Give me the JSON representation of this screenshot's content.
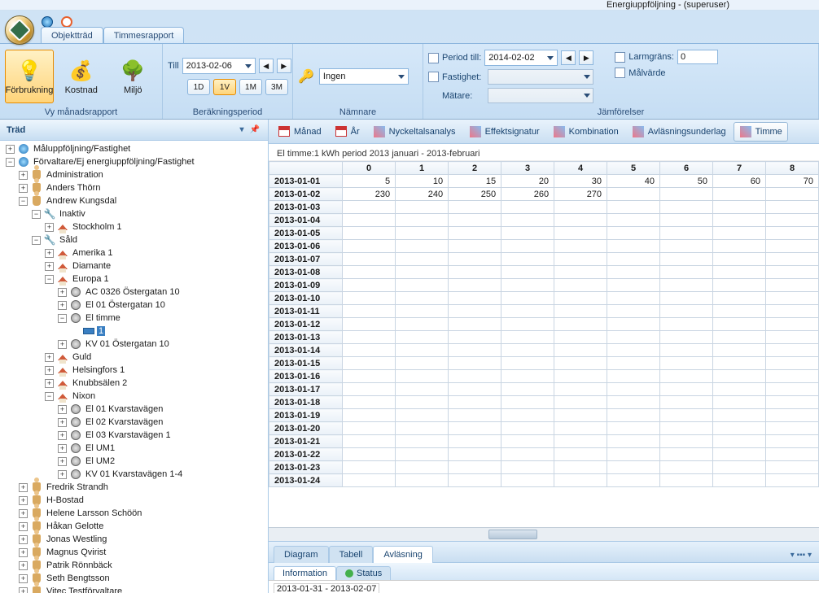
{
  "titlebar": {
    "text": "Energiuppföljning -   (superuser)"
  },
  "main_tabs": {
    "objekttrad": "Objektträd",
    "timmesrapport": "Timmesrapport"
  },
  "ribbon": {
    "group_vy": {
      "label": "Vy månadsrapport",
      "forbrukning": "Förbrukning",
      "kostnad": "Kostnad",
      "miljo": "Miljö"
    },
    "group_period": {
      "label": "Beräkningsperiod",
      "till": "Till",
      "date": "2013-02-06",
      "p1d": "1D",
      "p1v": "1V",
      "p1m": "1M",
      "p3m": "3M"
    },
    "group_namnare": {
      "label": "Nämnare",
      "value": "Ingen"
    },
    "group_jamf": {
      "label": "Jämförelser",
      "period_till": "Period till:",
      "period_date": "2014-02-02",
      "fastighet": "Fastighet:",
      "matare": "Mätare:",
      "larmgrans": "Larmgräns:",
      "larmgrans_val": "0",
      "malvarde": "Målvärde"
    }
  },
  "tree_title": "Träd",
  "tree": {
    "n1": "Måluppföljning/Fastighet",
    "n2": "Förvaltare/Ej energiuppföljning/Fastighet",
    "admin": "Administration",
    "thorn": "Anders Thörn",
    "kungsdal": "Andrew Kungsdal",
    "inaktiv": "Inaktiv",
    "stockholm1": "Stockholm 1",
    "sald": "Såld",
    "amerika1": "Amerika 1",
    "diamante": "Diamante",
    "europa1": "Europa 1",
    "ac0326": "AC 0326 Östergatan 10",
    "el01": "El 01 Östergatan 10",
    "eltimme": "El timme",
    "eltimme_child": "1",
    "kv01": "KV 01 Östergatan 10",
    "guld": "Guld",
    "helsingfors1": "Helsingfors 1",
    "knubbsalen2": "Knubbsälen 2",
    "nixon": "Nixon",
    "nel01": "El 01 Kvarstavägen",
    "nel02": "El 02 Kvarstavägen",
    "nel03": "El 03 Kvarstavägen 1",
    "elum1": "El UM1",
    "elum2": "El UM2",
    "nkv01": "KV 01 Kvarstavägen 1-4",
    "fredrik": "Fredrik Strandh",
    "hbostad": "H-Bostad",
    "helene": "Helene Larsson Schöön",
    "hakan": "Håkan Gelotte",
    "jonas": "Jonas Westling",
    "magnus": "Magnus Qvirist",
    "patrik": "Patrik Rönnbäck",
    "seth": "Seth Bengtsson",
    "vitec": "Vitec Testförvaltare"
  },
  "view_tabs": {
    "manad": "Månad",
    "ar": "År",
    "nyckeltal": "Nyckeltalsanalys",
    "effekt": "Effektsignatur",
    "kombination": "Kombination",
    "avlasunderlag": "Avläsningsunderlag",
    "timme": "Timme"
  },
  "grid": {
    "caption": "El timme:1  kWh period 2013 januari - 2013-februari",
    "cols": [
      "0",
      "1",
      "2",
      "3",
      "4",
      "5",
      "6",
      "7",
      "8"
    ],
    "rows": [
      {
        "d": "2013-01-01",
        "v": [
          "5",
          "10",
          "15",
          "20",
          "30",
          "40",
          "50",
          "60",
          "70"
        ]
      },
      {
        "d": "2013-01-02",
        "v": [
          "230",
          "240",
          "250",
          "260",
          "270",
          "",
          "",
          "",
          ""
        ]
      },
      {
        "d": "2013-01-03",
        "v": [
          "",
          "",
          "",
          "",
          "",
          "",
          "",
          "",
          ""
        ]
      },
      {
        "d": "2013-01-04",
        "v": [
          "",
          "",
          "",
          "",
          "",
          "",
          "",
          "",
          ""
        ]
      },
      {
        "d": "2013-01-05",
        "v": [
          "",
          "",
          "",
          "",
          "",
          "",
          "",
          "",
          ""
        ]
      },
      {
        "d": "2013-01-06",
        "v": [
          "",
          "",
          "",
          "",
          "",
          "",
          "",
          "",
          ""
        ]
      },
      {
        "d": "2013-01-07",
        "v": [
          "",
          "",
          "",
          "",
          "",
          "",
          "",
          "",
          ""
        ]
      },
      {
        "d": "2013-01-08",
        "v": [
          "",
          "",
          "",
          "",
          "",
          "",
          "",
          "",
          ""
        ]
      },
      {
        "d": "2013-01-09",
        "v": [
          "",
          "",
          "",
          "",
          "",
          "",
          "",
          "",
          ""
        ]
      },
      {
        "d": "2013-01-10",
        "v": [
          "",
          "",
          "",
          "",
          "",
          "",
          "",
          "",
          ""
        ]
      },
      {
        "d": "2013-01-11",
        "v": [
          "",
          "",
          "",
          "",
          "",
          "",
          "",
          "",
          ""
        ]
      },
      {
        "d": "2013-01-12",
        "v": [
          "",
          "",
          "",
          "",
          "",
          "",
          "",
          "",
          ""
        ]
      },
      {
        "d": "2013-01-13",
        "v": [
          "",
          "",
          "",
          "",
          "",
          "",
          "",
          "",
          ""
        ]
      },
      {
        "d": "2013-01-14",
        "v": [
          "",
          "",
          "",
          "",
          "",
          "",
          "",
          "",
          ""
        ]
      },
      {
        "d": "2013-01-15",
        "v": [
          "",
          "",
          "",
          "",
          "",
          "",
          "",
          "",
          ""
        ]
      },
      {
        "d": "2013-01-16",
        "v": [
          "",
          "",
          "",
          "",
          "",
          "",
          "",
          "",
          ""
        ]
      },
      {
        "d": "2013-01-17",
        "v": [
          "",
          "",
          "",
          "",
          "",
          "",
          "",
          "",
          ""
        ]
      },
      {
        "d": "2013-01-18",
        "v": [
          "",
          "",
          "",
          "",
          "",
          "",
          "",
          "",
          ""
        ]
      },
      {
        "d": "2013-01-19",
        "v": [
          "",
          "",
          "",
          "",
          "",
          "",
          "",
          "",
          ""
        ]
      },
      {
        "d": "2013-01-20",
        "v": [
          "",
          "",
          "",
          "",
          "",
          "",
          "",
          "",
          ""
        ]
      },
      {
        "d": "2013-01-21",
        "v": [
          "",
          "",
          "",
          "",
          "",
          "",
          "",
          "",
          ""
        ]
      },
      {
        "d": "2013-01-22",
        "v": [
          "",
          "",
          "",
          "",
          "",
          "",
          "",
          "",
          ""
        ]
      },
      {
        "d": "2013-01-23",
        "v": [
          "",
          "",
          "",
          "",
          "",
          "",
          "",
          "",
          ""
        ]
      },
      {
        "d": "2013-01-24",
        "v": [
          "",
          "",
          "",
          "",
          "",
          "",
          "",
          "",
          ""
        ]
      }
    ]
  },
  "subtabs": {
    "diagram": "Diagram",
    "tabell": "Tabell",
    "avlasning": "Avläsning"
  },
  "infotabs": {
    "information": "Information",
    "status": "Status"
  },
  "infopanel": {
    "range": "2013-01-31 - 2013-02-07"
  }
}
